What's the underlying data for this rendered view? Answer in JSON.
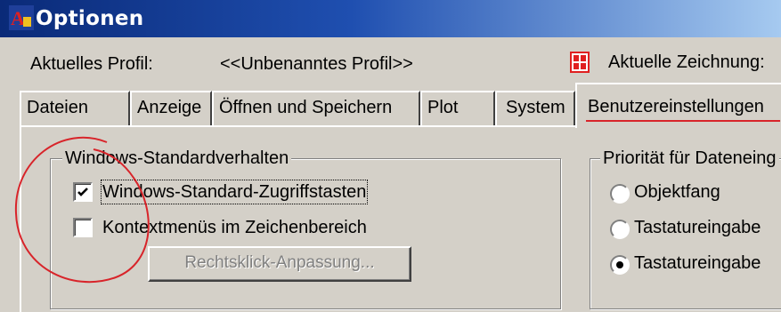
{
  "window": {
    "title": "Optionen"
  },
  "profile": {
    "label": "Aktuelles Profil:",
    "value": "<<Unbenanntes Profil>>",
    "drawing_label": "Aktuelle Zeichnung:"
  },
  "tabs": [
    {
      "label": "Dateien"
    },
    {
      "label": "Anzeige"
    },
    {
      "label": "Öffnen und Speichern"
    },
    {
      "label": "Plot"
    },
    {
      "label": "System"
    },
    {
      "label": "Benutzereinstellungen",
      "active": true
    }
  ],
  "windows_group": {
    "title": "Windows-Standardverhalten",
    "options": [
      {
        "label": "Windows-Standard-Zugriffstasten",
        "checked": true
      },
      {
        "label": "Kontextmenüs im Zeichenbereich",
        "checked": false
      }
    ],
    "button_label": "Rechtsklick-Anpassung..."
  },
  "priority_group": {
    "title": "Priorität für Dateneing",
    "options": [
      {
        "label": "Objektfang",
        "selected": false
      },
      {
        "label": "Tastatureingabe",
        "selected": false
      },
      {
        "label": "Tastatureingabe",
        "selected": true
      }
    ]
  },
  "colors": {
    "title_start": "#0a2a78",
    "title_end": "#a6caf0",
    "dialog_face": "#d4d0c8",
    "annotation": "#d8242a"
  }
}
